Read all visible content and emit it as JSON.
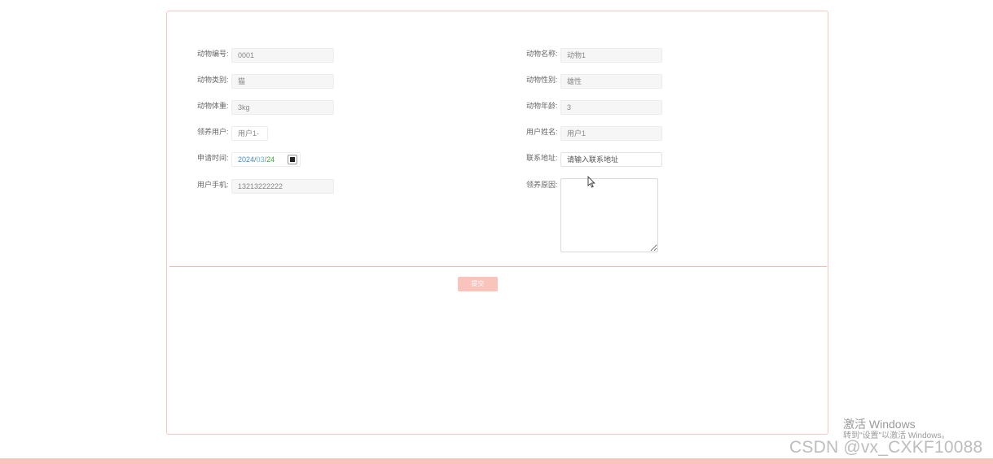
{
  "form": {
    "animal_id": {
      "label": "动物编号:",
      "value": "0001"
    },
    "animal_name": {
      "label": "动物名称:",
      "value": "动物1"
    },
    "animal_category": {
      "label": "动物类别:",
      "value": "猫"
    },
    "animal_gender": {
      "label": "动物性别:",
      "value": "雄性"
    },
    "animal_weight": {
      "label": "动物体重:",
      "value": "3kg"
    },
    "animal_age": {
      "label": "动物年龄:",
      "value": "3"
    },
    "adopt_user": {
      "label": "领养用户:",
      "value": "用户1-"
    },
    "user_name": {
      "label": "用户姓名:",
      "value": "用户1"
    },
    "apply_time": {
      "label": "申请时间:",
      "year": "2024",
      "month": "03",
      "day": "24",
      "sep": "/"
    },
    "address": {
      "label": "联系地址:",
      "placeholder": "请输入联系地址"
    },
    "user_phone": {
      "label": "用户手机:",
      "value": "13213222222"
    },
    "adopt_reason": {
      "label": "领养原因:",
      "value": ""
    }
  },
  "submit_label": "提交",
  "windows_activation": {
    "title": "激活 Windows",
    "subtitle": "转到\"设置\"以激活 Windows。"
  },
  "watermark": "CSDN @vx_CXKF10088",
  "colors": {
    "accent": "#f9c4bc",
    "panel_border": "#f4c9c4",
    "divider": "#f2b8b2"
  },
  "icons": {
    "calendar": "calendar-icon",
    "cursor": "mouse-cursor-icon"
  }
}
